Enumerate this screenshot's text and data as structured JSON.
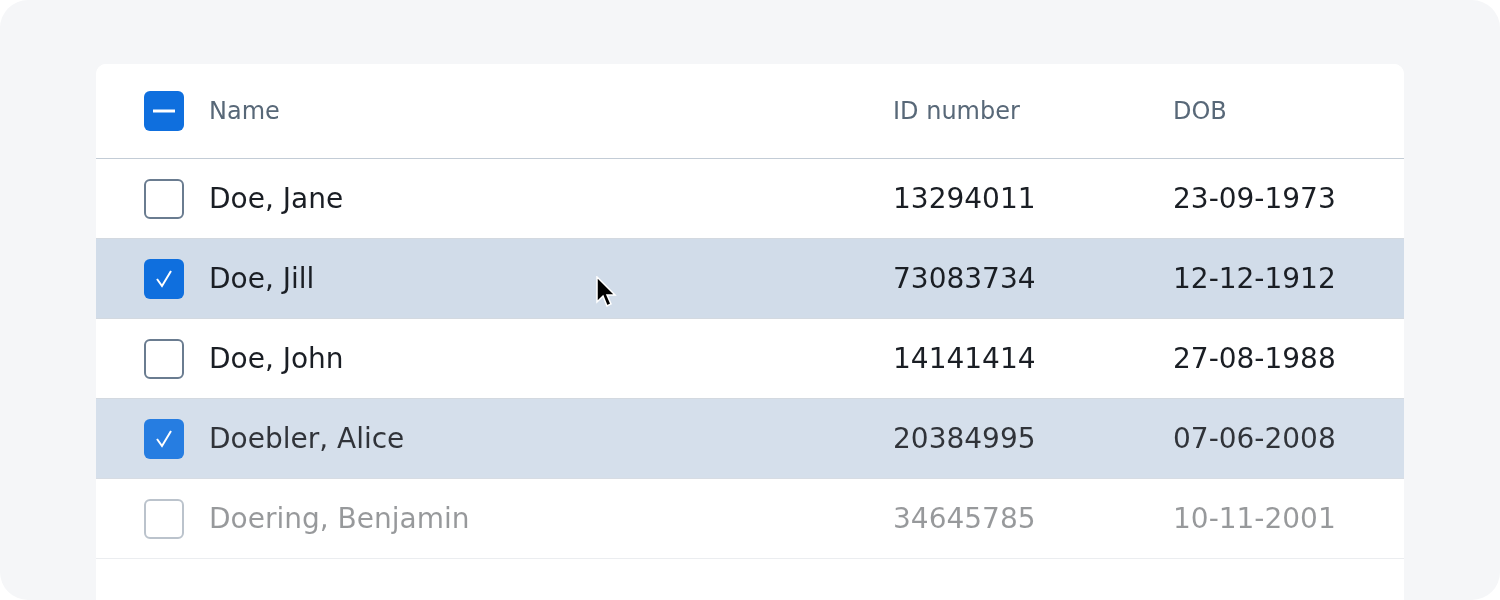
{
  "table": {
    "select_all": {
      "indeterminate": true
    },
    "columns": [
      "Name",
      "ID number",
      "DOB"
    ],
    "rows": [
      {
        "name": "Doe, Jane",
        "id": "13294011",
        "dob": "23-09-1973",
        "selected": false
      },
      {
        "name": "Doe, Jill",
        "id": "73083734",
        "dob": "12-12-1912",
        "selected": true
      },
      {
        "name": "Doe, John",
        "id": "14141414",
        "dob": "27-08-1988",
        "selected": false
      },
      {
        "name": "Doebler, Alice",
        "id": "20384995",
        "dob": "07-06-2008",
        "selected": true
      },
      {
        "name": "Doering, Benjamin",
        "id": "34645785",
        "dob": "10-11-2001",
        "selected": false
      }
    ]
  }
}
